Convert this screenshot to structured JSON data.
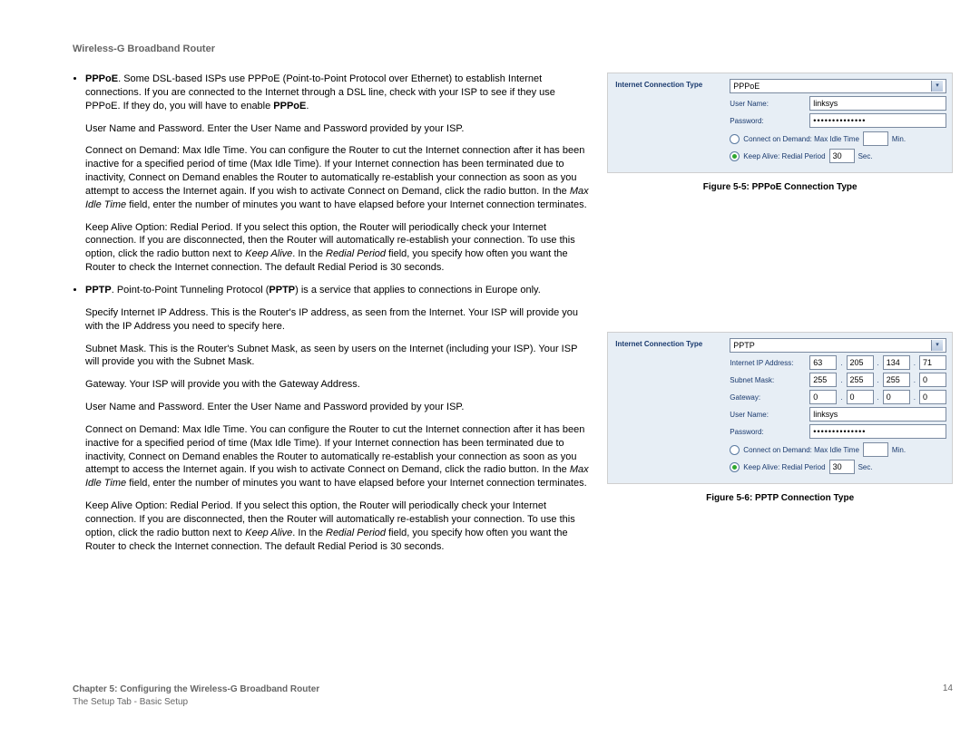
{
  "header": {
    "title": "Wireless-G Broadband Router"
  },
  "body": {
    "pppoe_intro_pre": "PPPoE",
    "pppoe_intro": ". Some DSL-based ISPs use PPPoE (Point-to-Point Protocol over Ethernet) to establish Internet connections. If you are connected to the Internet through a DSL line, check with your ISP to see if they use PPPoE. If they do, you will have to enable ",
    "pppoe_intro_bold_tail": "PPPoE",
    "pppoe_intro_end": ".",
    "user_pass": "User Name and Password. Enter the User Name and Password provided by your ISP.",
    "cod_pre": "Connect on Demand: Max Idle Time. You can configure the Router to cut the Internet connection after it has been inactive for a specified period of time (Max Idle Time). If your Internet connection has been terminated due to inactivity, Connect on Demand enables the Router to automatically re-establish your connection as soon as you attempt to access the Internet again. If you wish to activate Connect on Demand, click the radio button. In the ",
    "cod_i": "Max Idle Time",
    "cod_post": " field, enter the number of minutes you want to have elapsed before your Internet connection terminates.",
    "keep_pre": "Keep Alive Option: Redial Period. If you select this option, the Router will periodically check your Internet connection. If you are disconnected, then the Router will automatically re-establish your connection. To use this option, click the radio button next to ",
    "keep_i1": "Keep Alive",
    "keep_mid": ". In the ",
    "keep_i2": "Redial Period",
    "keep_post_a": " field, you specify how often you want the Router to check the Internet connection.  The default Redial Period is 30 seconds.",
    "keep_post_b": " field, you specify how often you want the Router to check the Internet connection. The default Redial Period is 30 seconds.",
    "pptp_pre": "PPTP",
    "pptp_text1": ". Point-to-Point Tunneling Protocol (",
    "pptp_b2": "PPTP",
    "pptp_text2": ") is a service that applies to connections in Europe only.",
    "spec_ip": "Specify Internet IP Address. This is the Router's IP address, as seen from the Internet. Your ISP will provide you with the IP Address you need to specify here.",
    "subnet": "Subnet Mask. This is the Router's Subnet Mask, as seen by users on the Internet (including your ISP). Your ISP will provide you with the Subnet Mask.",
    "gateway": "Gateway. Your ISP will provide you with the Gateway Address."
  },
  "fig55": {
    "panel_title": "Internet Connection Type",
    "select_value": "PPPoE",
    "user_label": "User Name:",
    "user_value": "linksys",
    "pass_label": "Password:",
    "pass_value": "••••••••••••••",
    "cod_label": "Connect on Demand: Max Idle Time",
    "cod_unit": "Min.",
    "keep_label": "Keep Alive: Redial Period",
    "keep_value": "30",
    "keep_unit": "Sec.",
    "caption": "Figure 5-5: PPPoE Connection Type"
  },
  "fig56": {
    "panel_title": "Internet Connection Type",
    "select_value": "PPTP",
    "ip_label": "Internet IP Address:",
    "ip": [
      "63",
      "205",
      "134",
      "71"
    ],
    "mask_label": "Subnet Mask:",
    "mask": [
      "255",
      "255",
      "255",
      "0"
    ],
    "gw_label": "Gateway:",
    "gw": [
      "0",
      "0",
      "0",
      "0"
    ],
    "user_label": "User Name:",
    "user_value": "linksys",
    "pass_label": "Password:",
    "pass_value": "••••••••••••••",
    "cod_label": "Connect on Demand: Max Idle Time",
    "cod_unit": "Min.",
    "keep_label": "Keep Alive: Redial Period",
    "keep_value": "30",
    "keep_unit": "Sec.",
    "caption": "Figure 5-6: PPTP Connection Type"
  },
  "footer": {
    "line1": "Chapter 5: Configuring the Wireless-G Broadband Router",
    "line2": "The Setup Tab - Basic Setup",
    "page": "14"
  }
}
